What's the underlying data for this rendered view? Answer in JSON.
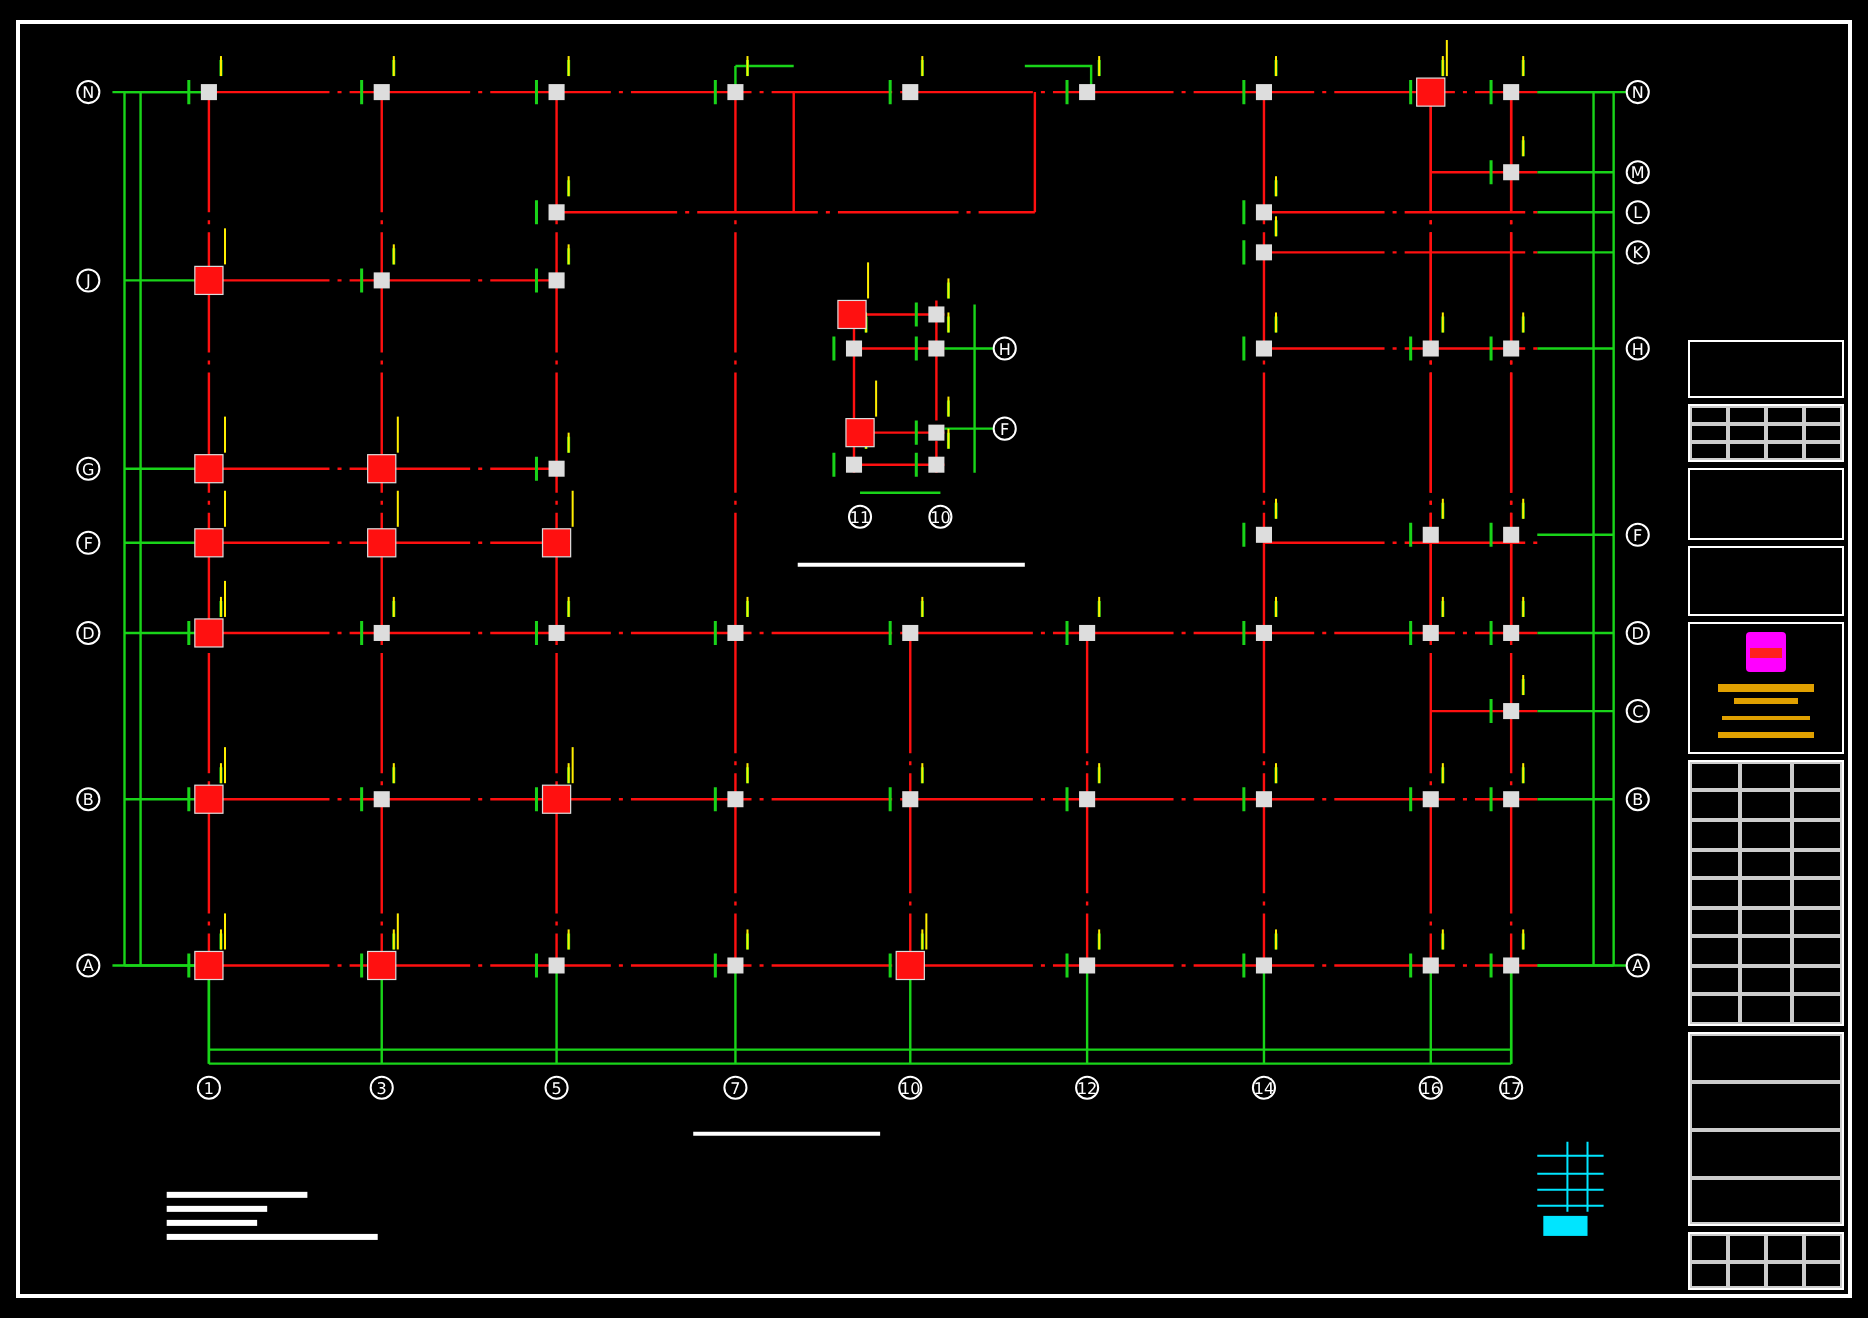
{
  "plan": {
    "left_axes": [
      "N",
      "J",
      "G",
      "F",
      "D",
      "B",
      "A"
    ],
    "right_axes": [
      "N",
      "M",
      "L",
      "K",
      "H",
      "F",
      "D",
      "C",
      "B",
      "A"
    ],
    "bottom_axes": [
      "1",
      "3",
      "5",
      "7",
      "10",
      "12",
      "14",
      "16",
      "17"
    ],
    "inset_right_axes": [
      "H",
      "F"
    ],
    "inset_bottom_axes": [
      "11",
      "10"
    ]
  }
}
